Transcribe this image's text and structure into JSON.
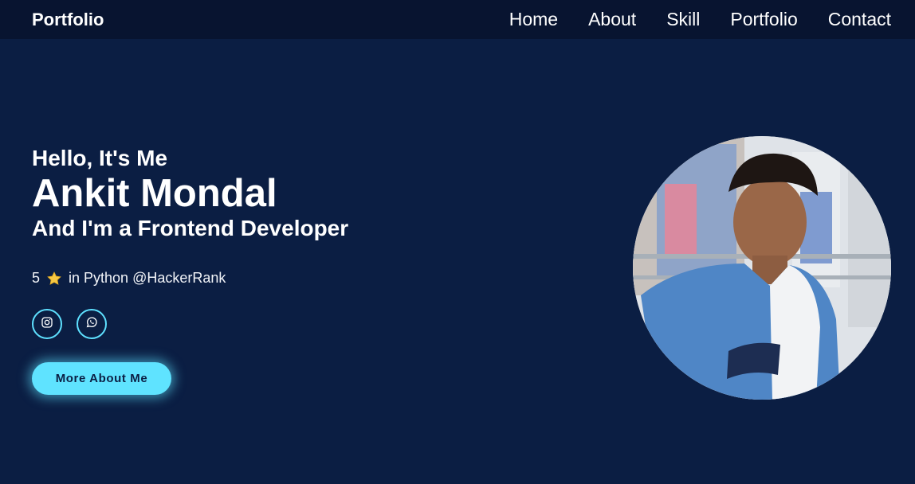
{
  "navbar": {
    "logo": "Portfolio",
    "links": [
      {
        "label": "Home"
      },
      {
        "label": "About"
      },
      {
        "label": "Skill"
      },
      {
        "label": "Portfolio"
      },
      {
        "label": "Contact"
      }
    ]
  },
  "hero": {
    "greeting": "Hello, It's Me",
    "name": "Ankit Mondal",
    "role": "And I'm a Frontend Developer",
    "rank_count": "5",
    "rank_text": "in Python @HackerRank",
    "social_icons": [
      "instagram-icon",
      "whatsapp-icon"
    ],
    "cta_label": "More About Me"
  },
  "colors": {
    "background": "#0b1e43",
    "navbar": "#081430",
    "accent": "#5fe3ff",
    "star": "#f7c842"
  }
}
